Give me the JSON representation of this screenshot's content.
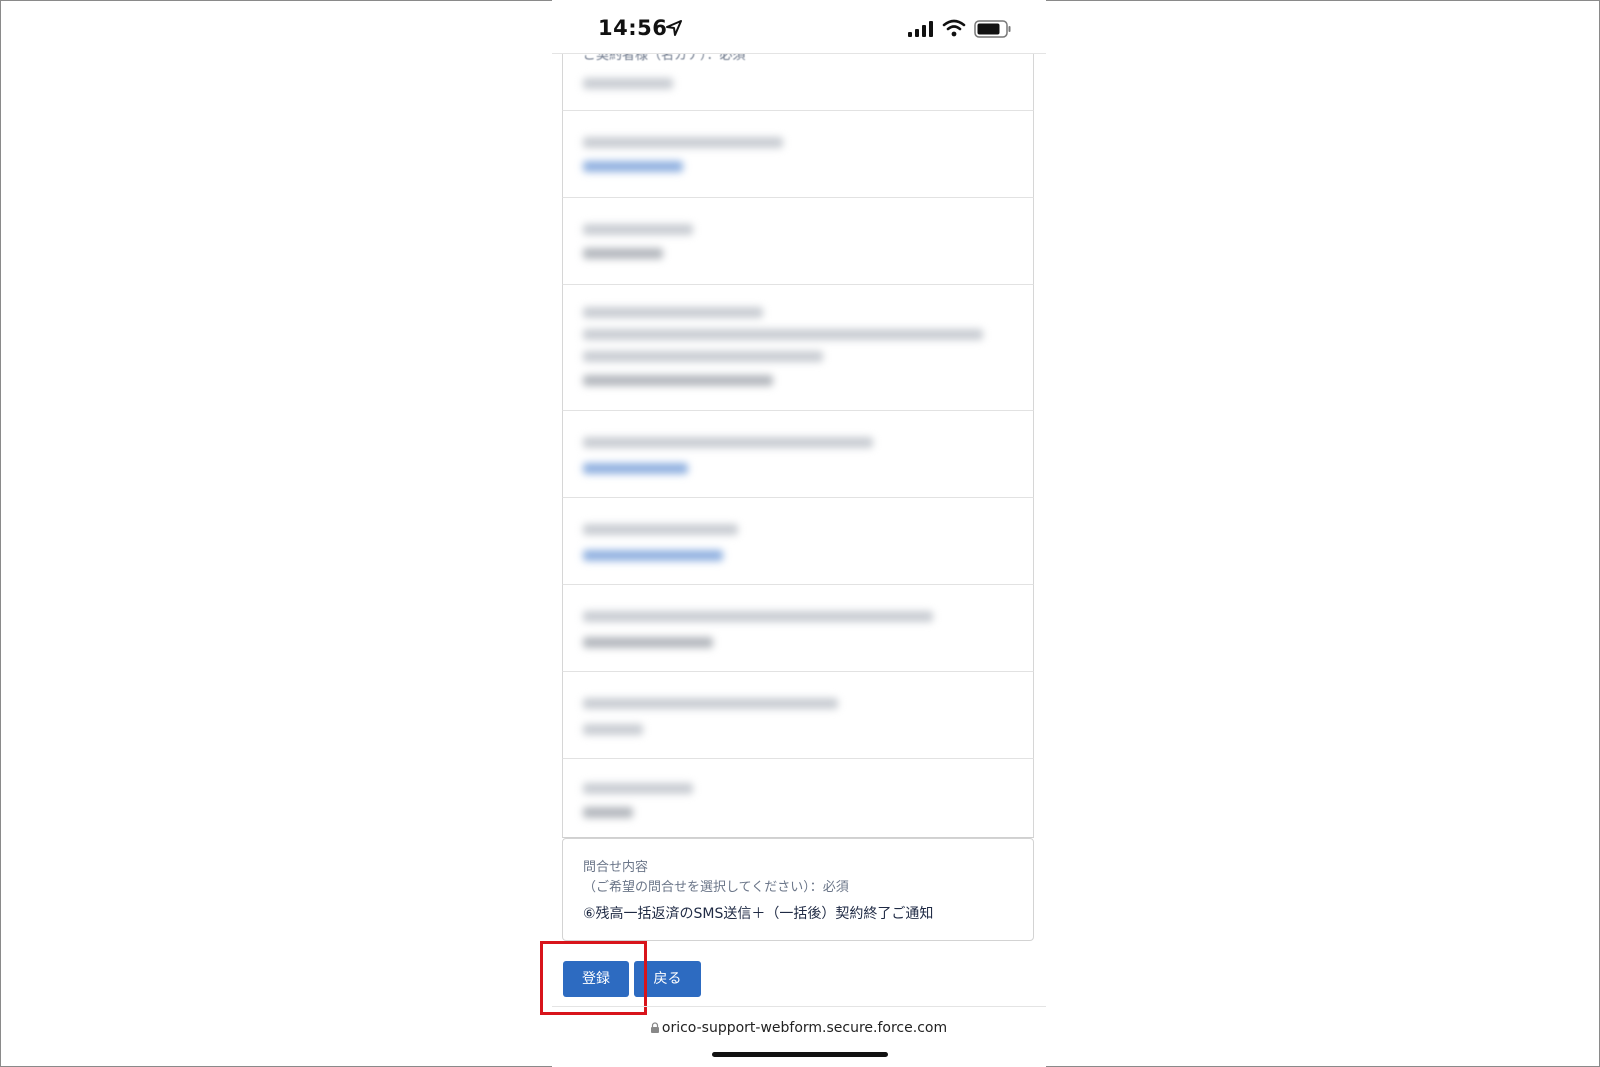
{
  "status_bar": {
    "time": "14:56",
    "icons": [
      "location-arrow-icon",
      "signal-icon",
      "wifi-icon",
      "battery-icon"
    ]
  },
  "form": {
    "first_field_label": "ご契約者様（名カナ）：必須",
    "inquiry": {
      "label_line1": "問合せ内容",
      "label_line2": "（ご希望の問合せを選択してください）：必須",
      "value": "⑥残高一括返済のSMS送信＋（一括後）契約終了ご通知"
    }
  },
  "buttons": {
    "register": "登録",
    "back": "戻る"
  },
  "browser": {
    "url": "orico-support-webform.secure.force.com"
  },
  "colors": {
    "button": "#2d6bc1",
    "highlight": "#d8141b",
    "label": "#6b7689"
  }
}
